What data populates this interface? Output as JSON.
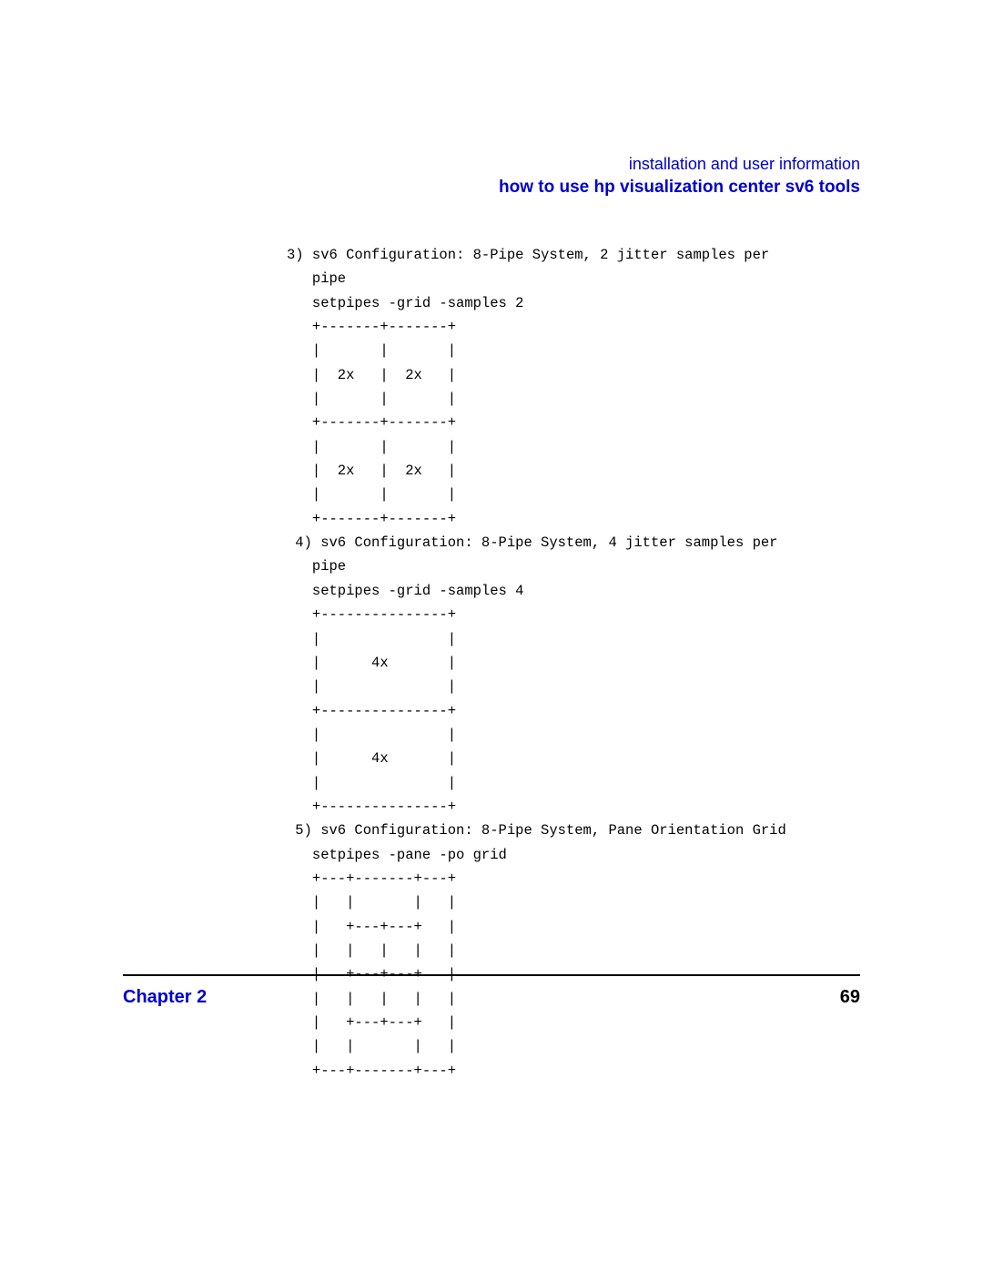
{
  "header": {
    "line1": "installation and user information",
    "line2": "how to use hp visualization center sv6 tools"
  },
  "body": {
    "text": "3) sv6 Configuration: 8-Pipe System, 2 jitter samples per\n   pipe\n   setpipes -grid -samples 2\n   +-------+-------+\n   |       |       |\n   |  2x   |  2x   |\n   |       |       |\n   +-------+-------+\n   |       |       |\n   |  2x   |  2x   |\n   |       |       |\n   +-------+-------+\n 4) sv6 Configuration: 8-Pipe System, 4 jitter samples per\n   pipe\n   setpipes -grid -samples 4\n   +---------------+\n   |               |\n   |      4x       |\n   |               |\n   +---------------+\n   |               |\n   |      4x       |\n   |               |\n   +---------------+\n 5) sv6 Configuration: 8-Pipe System, Pane Orientation Grid\n   setpipes -pane -po grid\n   +---+-------+---+\n   |   |       |   |\n   |   +---+---+   |\n   |   |   |   |   |\n   |   +---+---+   |\n   |   |   |   |   |\n   |   +---+---+   |\n   |   |       |   |\n   +---+-------+---+"
  },
  "footer": {
    "chapter": "Chapter 2",
    "page": "69"
  }
}
